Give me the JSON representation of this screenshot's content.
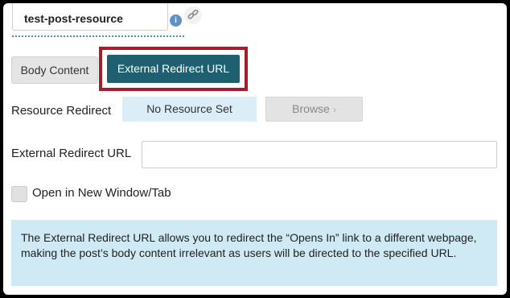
{
  "post": {
    "slug_value": "test-post-resource",
    "info_icon_glyph": "i"
  },
  "tabs": [
    {
      "label": "Body Content",
      "selected": false
    },
    {
      "label": "External Redirect URL",
      "selected": true
    }
  ],
  "resource_redirect": {
    "label": "Resource Redirect",
    "status": "No Resource Set",
    "browse_label": "Browse",
    "browse_chevron": "›"
  },
  "external_redirect": {
    "label": "External Redirect URL",
    "value": "",
    "placeholder": ""
  },
  "open_new_window": {
    "label": "Open in New Window/Tab",
    "checked": false
  },
  "info_message": "The External Redirect URL allows you to redirect the “Opens In” link to a different webpage, making the post’s body content irrelevant as users will be directed to the specified URL.",
  "icons": {
    "info": "info-icon",
    "link": "link-icon",
    "browse": "chevron-right-icon"
  },
  "colors": {
    "active_tab": "#1e6070",
    "highlight_border": "#a51c2c",
    "info_box_bg": "#cfeaf5",
    "resource_status_bg": "#dbeef7"
  }
}
